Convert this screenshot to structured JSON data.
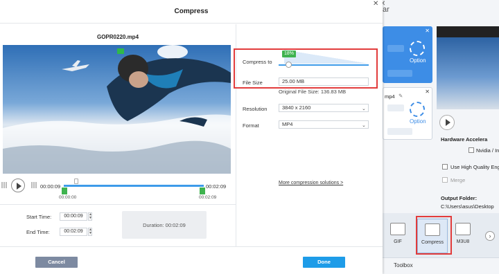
{
  "dialog": {
    "title": "Compress",
    "close_glyph": "✕",
    "filename": "GOPR0220.mp4",
    "player": {
      "current_time": "00:00:09",
      "end_time": "00:02:09",
      "start_marker": "00:00:00",
      "end_marker": "00:02:09",
      "position_fraction": 0.07
    },
    "trim": {
      "start_label": "Start Time:",
      "start_value": "00:00:09",
      "end_label": "End Time:",
      "end_value": "00:02:09",
      "duration_text": "Duration:  00:02:09"
    },
    "settings": {
      "compress_label": "Compress to",
      "compress_percent": "18%",
      "compress_fraction": 0.18,
      "file_size_label": "File Size",
      "file_size_value": "25.00  MB",
      "original_size": "Original File Size: 136.83 MB",
      "resolution_label": "Resolution",
      "resolution_value": "3840 x 2160",
      "format_label": "Format",
      "format_value": "MP4",
      "more_link": "More compression solutions >"
    },
    "buttons": {
      "cancel": "Cancel",
      "done": "Done"
    }
  },
  "background_app": {
    "title_fragment": "ar",
    "close_glyph": "✕",
    "card1": {
      "option_label": "Option",
      "close_glyph": "✕"
    },
    "card2": {
      "name_fragment": "mp4",
      "option_label": "Option",
      "close_glyph": "✕"
    },
    "hardware_label": "Hardware Accelera",
    "nvidia_label": "Nvidia / Int",
    "hq_label": "Use High Quality Engine",
    "merge_label": "Merge",
    "output_label": "Output Folder:",
    "output_path": "C:\\Users\\asus\\Desktop",
    "tools": [
      {
        "label": "GIF"
      },
      {
        "label": "Compress"
      },
      {
        "label": "M3U8"
      }
    ],
    "next_glyph": "›",
    "toolbox_label": "Toolbox"
  },
  "colors": {
    "accent": "#1e9ce8",
    "highlight_border": "#e23b3b",
    "badge_green": "#3fb34f"
  },
  "icons": [
    "close-icon",
    "play-icon",
    "gear-icon",
    "edit-icon",
    "gif-icon",
    "compress-icon",
    "m3u8-icon",
    "chevron-right-icon"
  ]
}
